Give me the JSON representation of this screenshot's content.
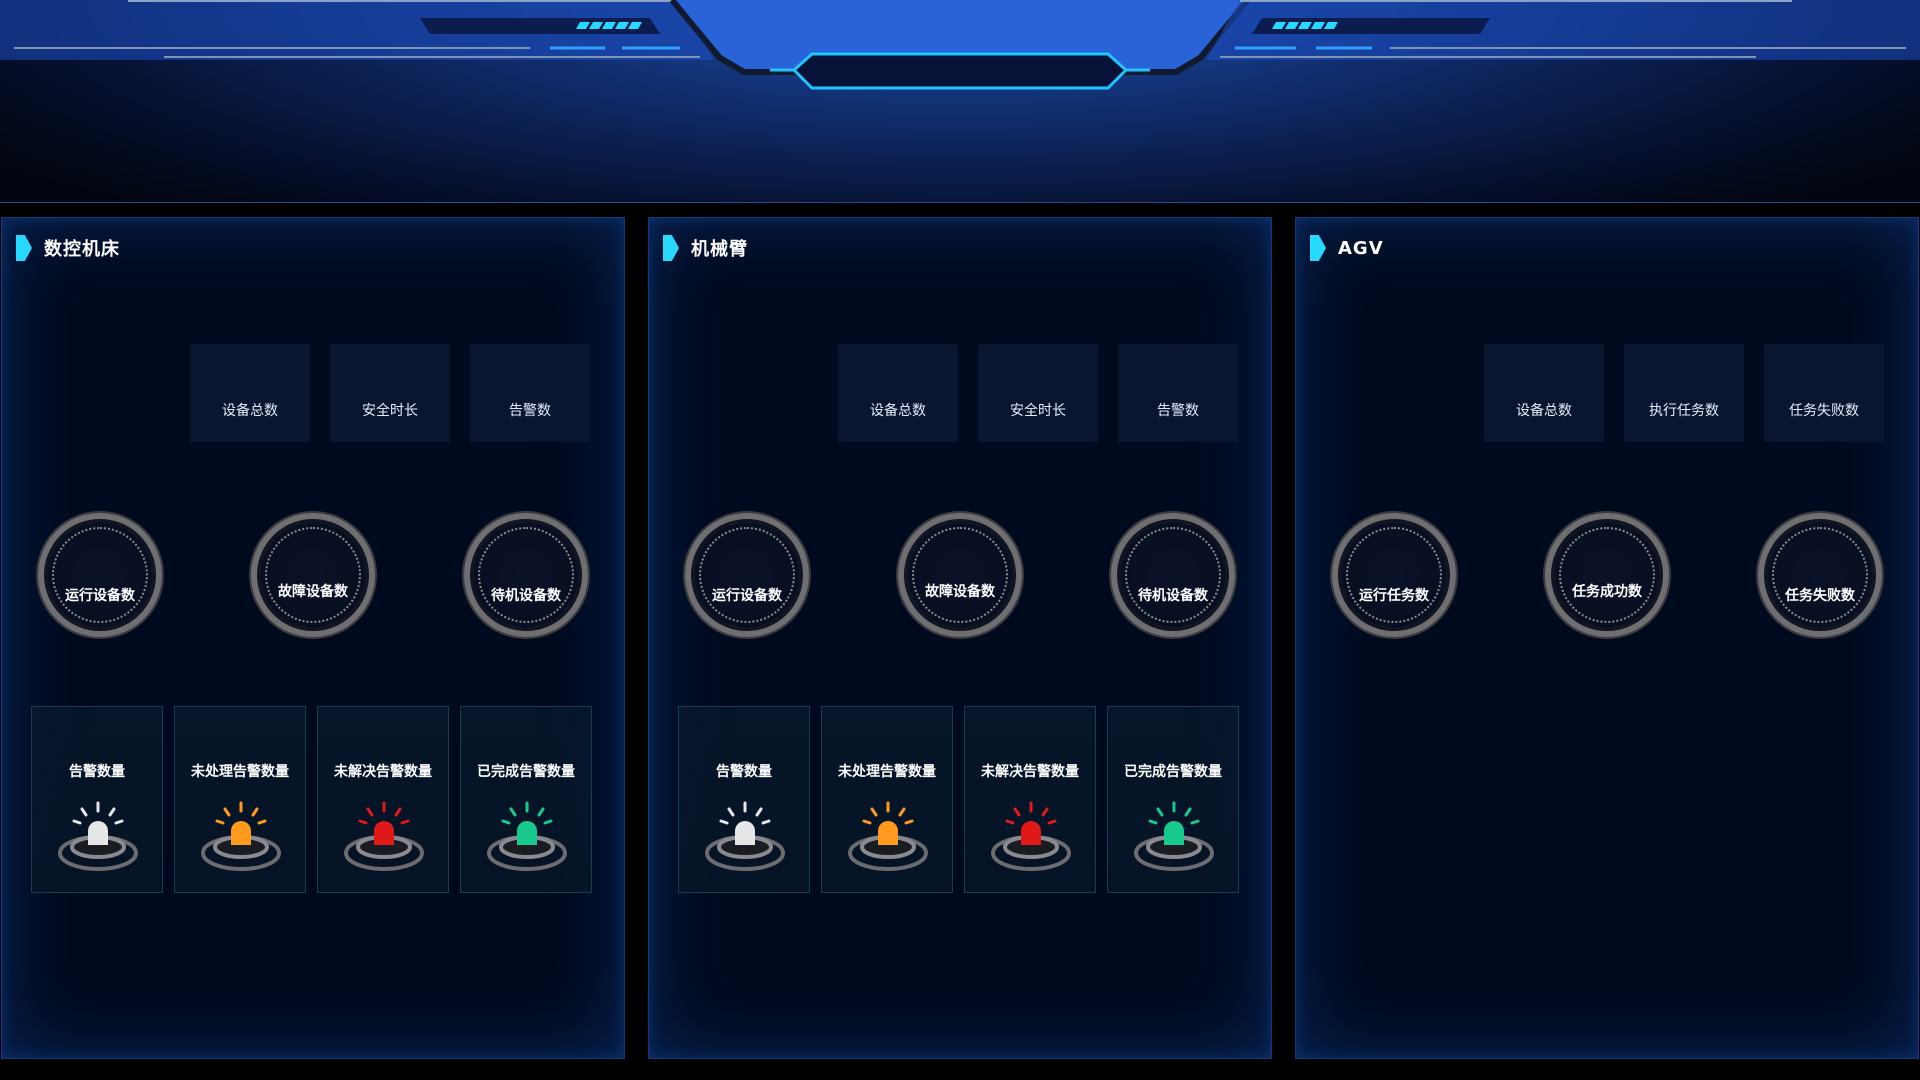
{
  "header": {
    "title": ""
  },
  "colors": {
    "accent": "#27d8ff",
    "alarm_white": "#e6e6e6",
    "alarm_orange": "#ff9a1f",
    "alarm_red": "#e01818",
    "alarm_green": "#17c98d",
    "gauge_ring": "#6f6f72"
  },
  "panels": [
    {
      "title": "数控机床",
      "stats": [
        "设备总数",
        "安全时长",
        "告警数"
      ],
      "gauges": [
        "运行设备数",
        "故障设备数",
        "待机设备数"
      ],
      "alarms": [
        {
          "label": "告警数量",
          "icon": "white-alarm-light-icon"
        },
        {
          "label": "未处理告警数量",
          "icon": "orange-alarm-light-icon"
        },
        {
          "label": "未解决告警数量",
          "icon": "red-alarm-light-icon"
        },
        {
          "label": "已完成告警数量",
          "icon": "green-alarm-light-icon"
        }
      ]
    },
    {
      "title": "机械臂",
      "stats": [
        "设备总数",
        "安全时长",
        "告警数"
      ],
      "gauges": [
        "运行设备数",
        "故障设备数",
        "待机设备数"
      ],
      "alarms": [
        {
          "label": "告警数量",
          "icon": "white-alarm-light-icon"
        },
        {
          "label": "未处理告警数量",
          "icon": "orange-alarm-light-icon"
        },
        {
          "label": "未解决告警数量",
          "icon": "red-alarm-light-icon"
        },
        {
          "label": "已完成告警数量",
          "icon": "green-alarm-light-icon"
        }
      ]
    },
    {
      "title": "AGV",
      "stats": [
        "设备总数",
        "执行任务数",
        "任务失败数"
      ],
      "gauges": [
        "运行任务数",
        "任务成功数",
        "任务失败数"
      ]
    }
  ]
}
